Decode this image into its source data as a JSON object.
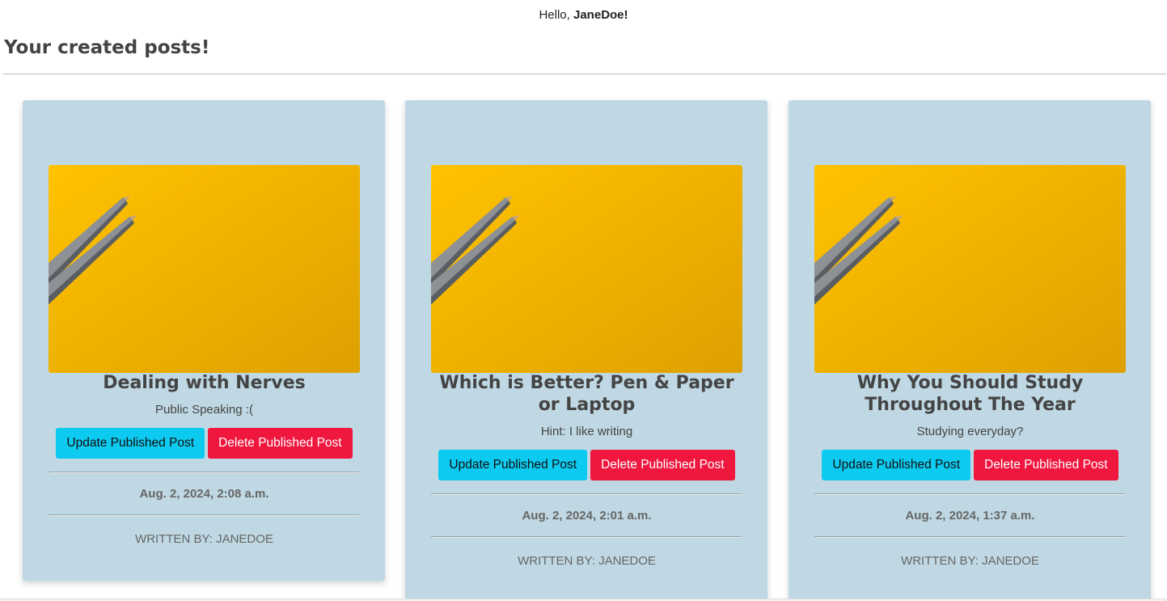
{
  "header": {
    "greeting_prefix": "Hello,",
    "username": "JaneDoe!"
  },
  "section": {
    "title": "Your created posts!"
  },
  "buttons": {
    "update_label": "Update Published Post",
    "delete_label": "Delete Published Post"
  },
  "colors": {
    "card_background": "#bfd8e3",
    "update_button": "#0dcaf0",
    "delete_button": "#f0173e",
    "image_background": "#f5b400"
  },
  "posts": [
    {
      "title": "Dealing with Nerves",
      "subtitle": "Public Speaking :(",
      "date": "Aug. 2, 2024, 2:08 a.m.",
      "author": "WRITTEN BY: JANEDOE",
      "image": "pencils-on-yellow"
    },
    {
      "title": "Which is Better? Pen & Paper or Laptop",
      "subtitle": "Hint: I like writing",
      "date": "Aug. 2, 2024, 2:01 a.m.",
      "author": "WRITTEN BY: JANEDOE",
      "image": "pencils-on-yellow"
    },
    {
      "title": "Why You Should Study Throughout The Year",
      "subtitle": "Studying everyday?",
      "date": "Aug. 2, 2024, 1:37 a.m.",
      "author": "WRITTEN BY: JANEDOE",
      "image": "pencils-on-yellow"
    }
  ]
}
